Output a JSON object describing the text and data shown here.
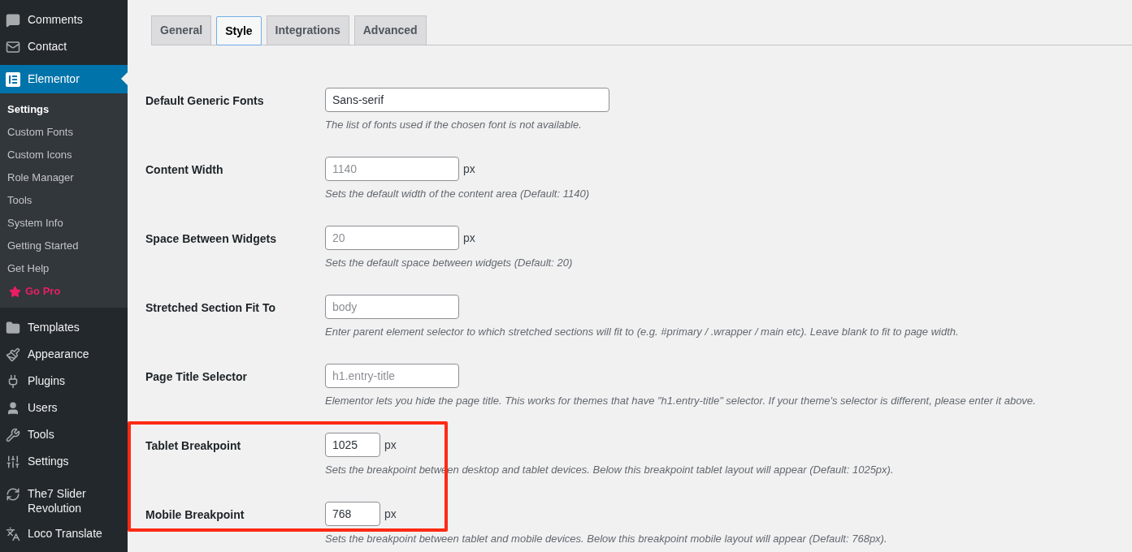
{
  "sidebar": {
    "items": [
      {
        "label": "Comments",
        "current": false
      },
      {
        "label": "Contact",
        "current": false
      },
      {
        "label": "Elementor",
        "current": true,
        "submenu": [
          {
            "label": "Settings",
            "selected": true,
            "kind": "link"
          },
          {
            "label": "Custom Fonts",
            "selected": false,
            "kind": "link"
          },
          {
            "label": "Custom Icons",
            "selected": false,
            "kind": "link"
          },
          {
            "label": "Role Manager",
            "selected": false,
            "kind": "link"
          },
          {
            "label": "Tools",
            "selected": false,
            "kind": "link"
          },
          {
            "label": "System Info",
            "selected": false,
            "kind": "link"
          },
          {
            "label": "Getting Started",
            "selected": false,
            "kind": "link"
          },
          {
            "label": "Get Help",
            "selected": false,
            "kind": "link"
          },
          {
            "label": "Go Pro",
            "selected": false,
            "kind": "promo"
          }
        ]
      },
      {
        "label": "Templates",
        "current": false
      },
      {
        "label": "Appearance",
        "current": false
      },
      {
        "label": "Plugins",
        "current": false
      },
      {
        "label": "Users",
        "current": false
      },
      {
        "label": "Tools",
        "current": false
      },
      {
        "label": "Settings",
        "current": false
      },
      {
        "label": "The7 Slider Revolution",
        "current": false
      },
      {
        "label": "Loco Translate",
        "current": false
      }
    ]
  },
  "tabs": [
    {
      "label": "General",
      "selected": false
    },
    {
      "label": "Style",
      "selected": true
    },
    {
      "label": "Integrations",
      "selected": false
    },
    {
      "label": "Advanced",
      "selected": false
    }
  ],
  "fields": [
    {
      "label": "Default Generic Fonts",
      "kind": "wide",
      "value": "Sans-serif",
      "description": "The list of fonts used if the chosen font is not available.",
      "highlighted": false
    },
    {
      "label": "Content Width",
      "kind": "regular",
      "placeholder": "1140",
      "unit": "px",
      "description": "Sets the default width of the content area (Default: 1140)",
      "highlighted": false
    },
    {
      "label": "Space Between Widgets",
      "kind": "regular",
      "placeholder": "20",
      "unit": "px",
      "description": "Sets the default space between widgets (Default: 20)",
      "highlighted": false
    },
    {
      "label": "Stretched Section Fit To",
      "kind": "regular",
      "placeholder": "body",
      "description": "Enter parent element selector to which stretched sections will fit to (e.g. #primary / .wrapper / main etc). Leave blank to fit to page width.",
      "highlighted": false
    },
    {
      "label": "Page Title Selector",
      "kind": "regular",
      "placeholder": "h1.entry-title",
      "description": "Elementor lets you hide the page title. This works for themes that have \"h1.entry-title\" selector. If your theme's selector is different, please enter it above.",
      "highlighted": false
    },
    {
      "label": "Tablet Breakpoint",
      "kind": "small",
      "value": "1025",
      "unit": "px",
      "description": "Sets the breakpoint between desktop and tablet devices. Below this breakpoint tablet layout will appear (Default: 1025px).",
      "highlighted": true
    },
    {
      "label": "Mobile Breakpoint",
      "kind": "small",
      "value": "768",
      "unit": "px",
      "description": "Sets the breakpoint between tablet and mobile devices. Below this breakpoint mobile layout will appear (Default: 768px).",
      "highlighted": true
    }
  ]
}
